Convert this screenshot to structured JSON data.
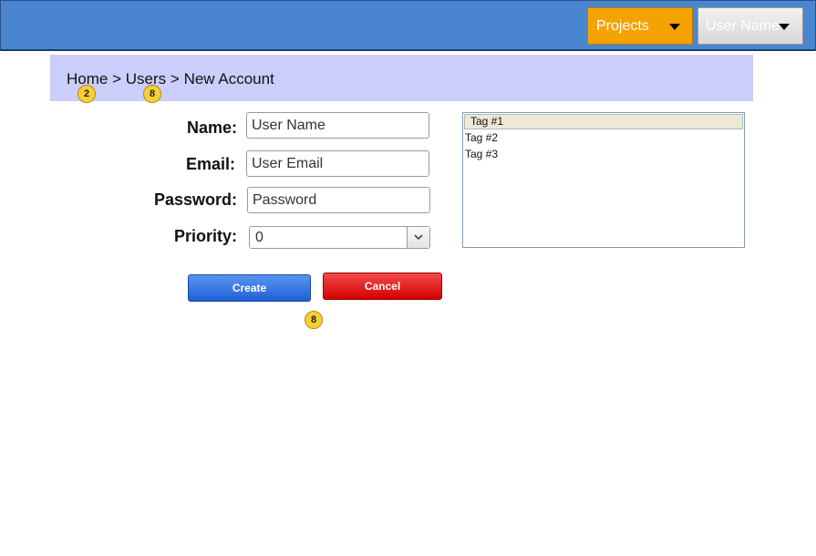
{
  "header": {
    "projects_label": "Projects",
    "user_label": "User Name"
  },
  "breadcrumb": {
    "home": "Home",
    "sep1": ">",
    "users": "Users",
    "sep2": ">",
    "current": "New Account"
  },
  "badges": {
    "home": "2",
    "users": "8",
    "actions": "8"
  },
  "form": {
    "name_label": "Name:",
    "name_value": "User Name",
    "email_label": "Email:",
    "email_value": "User Email",
    "password_label": "Password:",
    "password_value": "Password",
    "priority_label": "Priority:",
    "priority_value": "0"
  },
  "tags": {
    "items": [
      "Tag #1",
      "Tag #2",
      "Tag #3"
    ],
    "selected_index": 0
  },
  "actions": {
    "create_label": "Create",
    "cancel_label": "Cancel"
  },
  "colors": {
    "header_bg": "#4a86cf",
    "projects_bg": "#f5a300",
    "breadcrumb_bg": "#cbcdfb",
    "create_bg": "#2f6fe0",
    "cancel_bg": "#e01010",
    "badge_bg": "#f7cf35"
  },
  "icons": {
    "projects_dropdown": "chevron-down-icon",
    "user_dropdown": "chevron-down-icon",
    "priority_dropdown": "chevron-down-icon"
  }
}
